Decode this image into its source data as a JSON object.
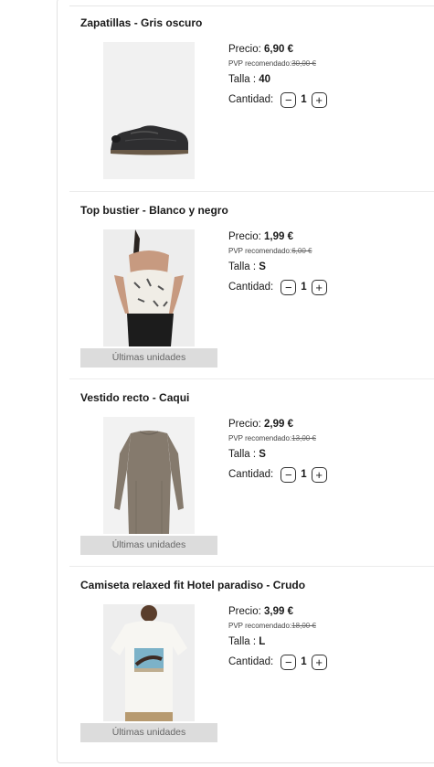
{
  "labels": {
    "price_label": "Precio:",
    "pvp_label": "PVP recomendado:",
    "size_label": "Talla :",
    "quantity_label": "Cantidad:",
    "last_units": "Últimas unidades",
    "minus": "−",
    "plus": "+"
  },
  "items": [
    {
      "title": "Zapatillas - Gris oscuro",
      "price": "6,90 €",
      "pvp": "30,00 €",
      "size": "40",
      "quantity": "1",
      "image": "sneakers-dark-grey",
      "last_units": false
    },
    {
      "title": "Top bustier - Blanco y negro",
      "price": "1,99 €",
      "pvp": "6,00 €",
      "size": "S",
      "quantity": "1",
      "image": "bustier-top-print",
      "last_units": true
    },
    {
      "title": "Vestido recto - Caqui",
      "price": "2,99 €",
      "pvp": "13,00 €",
      "size": "S",
      "quantity": "1",
      "image": "straight-dress-khaki",
      "last_units": true
    },
    {
      "title": "Camiseta relaxed fit Hotel paradiso - Crudo",
      "price": "3,99 €",
      "pvp": "18,00 €",
      "size": "L",
      "quantity": "1",
      "image": "tshirt-hotel-paradiso",
      "last_units": true
    }
  ]
}
